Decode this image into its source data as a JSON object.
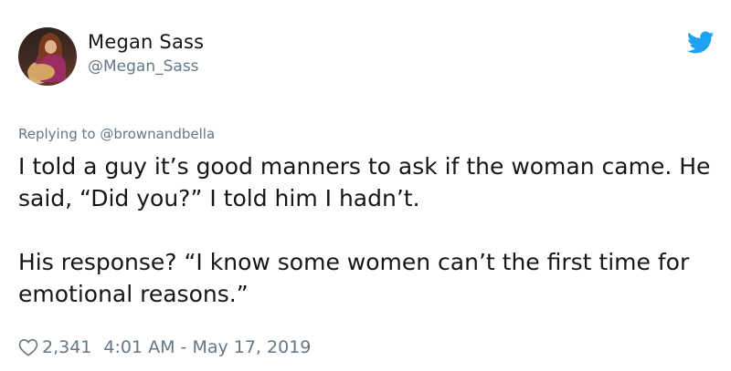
{
  "author": {
    "display_name": "Megan Sass",
    "handle": "@Megan_Sass",
    "avatar": "profile-photo-woman-with-guitar"
  },
  "reply": {
    "text": "Replying to @brownandbella"
  },
  "tweet": {
    "paragraphs": [
      "I told a guy it’s good manners to ask if the woman came. He said, “Did you?” I told him I hadn’t.",
      "His response? “I know some women can’t the first time for emotional reasons.”"
    ]
  },
  "meta": {
    "likes": "2,341",
    "timestamp": "4:01 AM - May 17, 2019",
    "like_icon": "heart-icon"
  },
  "brand": {
    "icon": "twitter-bird-icon",
    "color": "#1da1f2"
  }
}
